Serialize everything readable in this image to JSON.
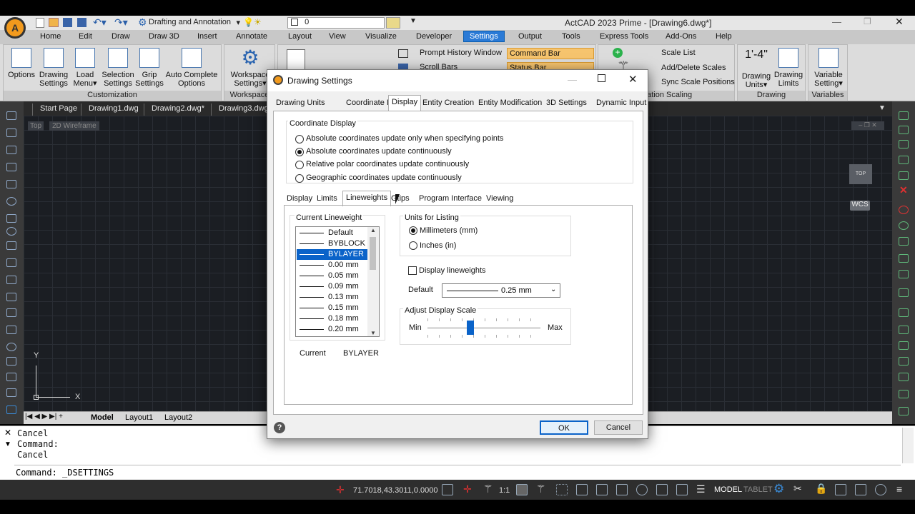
{
  "title_bar": {
    "workspace": "Drafting and Annotation",
    "layer_value": "0",
    "app_title": "ActCAD 2023 Prime - [Drawing6.dwg*]"
  },
  "menu": [
    "Home",
    "Edit",
    "Draw",
    "Draw 3D",
    "Insert",
    "Annotate",
    "Layout",
    "View",
    "Visualize",
    "Developer",
    "Settings",
    "Output",
    "Tools",
    "Express Tools",
    "Add-Ons",
    "Help"
  ],
  "menu_active": "Settings",
  "ribbon": {
    "customization": {
      "buttons": [
        "Options",
        "Drawing Settings",
        "Load Menu▾",
        "Selection Settings",
        "Grip Settings",
        "Auto Complete Options"
      ],
      "label": "Customization"
    },
    "workspace": {
      "button": "Workspace Settings▾",
      "label": "Workspace"
    },
    "ui": {
      "prompt_history": "Prompt History Window",
      "command_bar": "Command Bar",
      "scroll_bars": "Scroll Bars",
      "status_bar": "Status Bar"
    },
    "scales": {
      "scale_list": "Scale List",
      "add_delete": "Add/Delete Scales",
      "sync": "Sync Scale Positions",
      "label": "otation Scaling"
    },
    "drawing": {
      "units_icon": "1'-4\"",
      "units": "Drawing Units▾",
      "limits": "Drawing Limits",
      "label": "Drawing"
    },
    "variables": {
      "button": "Variable Setting▾",
      "label": "Variables"
    }
  },
  "doc_tabs": [
    "Start Page",
    "Drawing1.dwg",
    "Drawing2.dwg*",
    "Drawing3.dwg"
  ],
  "viewport": {
    "view": "Top",
    "style": "2D Wireframe",
    "cube": "TOP",
    "wcs": "WCS",
    "x": "X",
    "y": "Y"
  },
  "layout_tabs": [
    "Model",
    "Layout1",
    "Layout2"
  ],
  "command_history": [
    "Cancel",
    "Command:",
    "Cancel"
  ],
  "command_line": "Command: _DSETTINGS",
  "status": {
    "coords": "71.7018,43.3011,0.0000",
    "scale": "1:1",
    "model": "MODEL",
    "tablet": "TABLET"
  },
  "dialog": {
    "title": "Drawing Settings",
    "tabs": [
      "Drawing Units",
      "Coordinate Input",
      "Display",
      "Entity Creation",
      "Entity Modification",
      "3D Settings",
      "Dynamic Input"
    ],
    "tab_selected": "Display",
    "coord_group": "Coordinate Display",
    "coord_options": [
      "Absolute coordinates update only when specifying points",
      "Absolute coordinates update continuously",
      "Relative polar coordinates update continuously",
      "Geographic coordinates update continuously"
    ],
    "coord_selected": 1,
    "subtabs": [
      "Display",
      "Limits",
      "Lineweights",
      "Gtips",
      "Program Interface",
      "Viewing"
    ],
    "subtab_selected": "Lineweights",
    "current_lw_group": "Current Lineweight",
    "lineweights": [
      "Default",
      "BYBLOCK",
      "BYLAYER",
      "0.00 mm",
      "0.05 mm",
      "0.09 mm",
      "0.13 mm",
      "0.15 mm",
      "0.18 mm",
      "0.20 mm"
    ],
    "lw_selected": 2,
    "current_label": "Current",
    "current_value": "BYLAYER",
    "units_group": "Units for Listing",
    "units_options": [
      "Millimeters (mm)",
      "Inches (in)"
    ],
    "units_selected": 0,
    "display_lw": "Display lineweights",
    "display_lw_checked": false,
    "default_label": "Default",
    "default_value": "0.25 mm",
    "scale_group": "Adjust Display Scale",
    "scale_min": "Min",
    "scale_max": "Max",
    "scale_level": 0.38,
    "ok": "OK",
    "cancel": "Cancel"
  }
}
